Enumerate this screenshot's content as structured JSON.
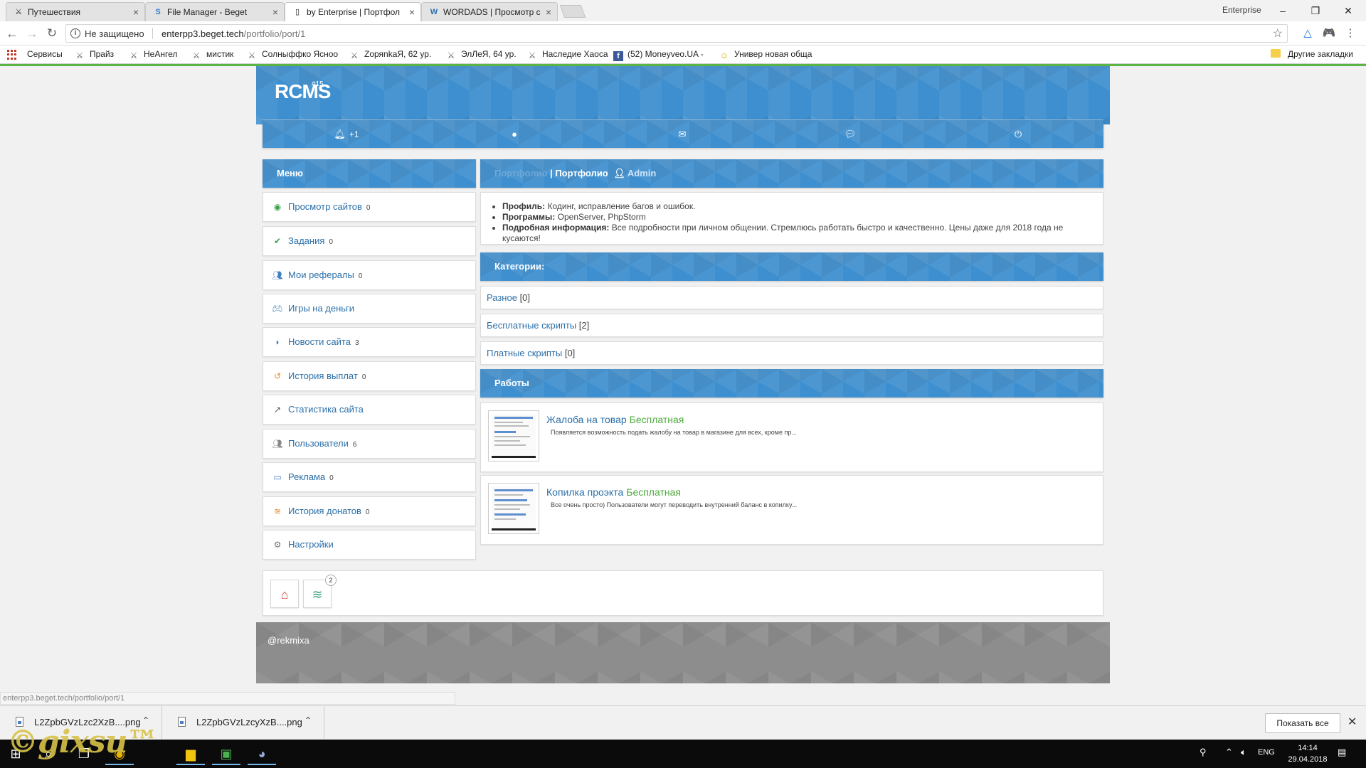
{
  "browser": {
    "tabs": [
      {
        "title": "Путешествия",
        "favicon": "sword-icon",
        "active": false
      },
      {
        "title": "File Manager - Beget",
        "favicon": "beget-icon",
        "active": false
      },
      {
        "title": "by Enterprise | Портфол",
        "favicon": "page-icon",
        "active": true
      },
      {
        "title": "WORDADS | Просмотр с",
        "favicon": "w-icon",
        "active": false
      }
    ],
    "profile_name": "Enterprise",
    "security_label": "Не защищено",
    "url_host": "enterpp3.beget.tech",
    "url_path": "/portfolio/port/1",
    "bookmarks": [
      {
        "label": "Сервисы",
        "icon": "apps-icon"
      },
      {
        "label": "Прайз",
        "icon": "sword-icon"
      },
      {
        "label": "НеАнгел",
        "icon": "sword-icon"
      },
      {
        "label": "мистик",
        "icon": "sword-icon"
      },
      {
        "label": "Солныффко Ясноо",
        "icon": "sword-icon"
      },
      {
        "label": "ZоряnkaЯ, 62 ур.",
        "icon": "sword-icon"
      },
      {
        "label": "ЭлЛеЯ, 64 ур.",
        "icon": "sword-icon"
      },
      {
        "label": "Наследие Хаоса",
        "icon": "sword-icon"
      },
      {
        "label": "(52) Moneyveo.UA -",
        "icon": "facebook-icon"
      },
      {
        "label": "Универ новая обща",
        "icon": "smiley-icon"
      }
    ],
    "other_bookmarks": "Другие закладки"
  },
  "site": {
    "logo": "RCMS",
    "logo_sup": "#15",
    "topnav": [
      {
        "icon": "bell-icon",
        "badge": "+1"
      },
      {
        "icon": "user-icon",
        "badge": ""
      },
      {
        "icon": "envelope-icon",
        "badge": ""
      },
      {
        "icon": "chat-icon",
        "badge": ""
      },
      {
        "icon": "power-icon",
        "badge": ""
      }
    ],
    "menu_title": "Меню",
    "menu": [
      {
        "label": "Просмотр сайтов",
        "count": "0",
        "icon": "eye-icon",
        "color": "#3aa04a"
      },
      {
        "label": "Задания",
        "count": "0",
        "icon": "check-icon",
        "color": "#3aa04a"
      },
      {
        "label": "Мои рефералы",
        "count": "0",
        "icon": "users-icon",
        "color": "#3f7fc0"
      },
      {
        "label": "Игры на деньги",
        "count": "",
        "icon": "gamepad-icon",
        "color": "#3f7fc0"
      },
      {
        "label": "Новости сайта",
        "count": "3",
        "icon": "rss-icon",
        "color": "#3f7fc0"
      },
      {
        "label": "История выплат",
        "count": "0",
        "icon": "history-icon",
        "color": "#e58a2b"
      },
      {
        "label": "Статистика сайта",
        "count": "",
        "icon": "chart-icon",
        "color": "#555555"
      },
      {
        "label": "Пользователи",
        "count": "6",
        "icon": "group-icon",
        "color": "#888888"
      },
      {
        "label": "Реклама",
        "count": "0",
        "icon": "monitor-icon",
        "color": "#3f7fc0"
      },
      {
        "label": "История донатов",
        "count": "0",
        "icon": "donate-icon",
        "color": "#e58a2b"
      },
      {
        "label": "Настройки",
        "count": "",
        "icon": "gear-icon",
        "color": "#777777"
      }
    ],
    "breadcrumb": {
      "link": "Портфолио",
      "separator": " | ",
      "current": "Портфолио",
      "user": "Admin"
    },
    "profile": [
      {
        "label": "Профиль:",
        "value": "Кодинг, исправление багов и ошибок."
      },
      {
        "label": "Программы:",
        "value": "OpenServer, PhpStorm"
      },
      {
        "label": "Подробная информация:",
        "value": "Все подробности при личном общении. Стремлюсь работать быстро и качественно. Цены даже для 2018 года не кусаются!"
      }
    ],
    "categories_title": "Категории:",
    "categories": [
      {
        "label": "Разное",
        "count": "[0]"
      },
      {
        "label": "Бесплатные скрипты",
        "count": "[2]"
      },
      {
        "label": "Платные скрипты",
        "count": "[0]"
      }
    ],
    "works_title": "Работы",
    "works": [
      {
        "title": "Жалоба на товар",
        "price": "Бесплатная",
        "desc": "Появляется возможность подать жалобу на товар в магазине для всех, кроме пр..."
      },
      {
        "title": "Копилка проэкта",
        "price": "Бесплатная",
        "desc": "Все очень просто) Пользователи могут переводить внутренний баланс в копилку..."
      }
    ],
    "bottom_badge": "2",
    "footer": "@rekmixa",
    "accent": "#3e8fcf"
  },
  "status_url": "enterpp3.beget.tech/portfolio/port/1",
  "downloads": {
    "items": [
      {
        "name": "L2ZpbGVzLzc2XzB....png"
      },
      {
        "name": "L2ZpbGVzLzcyXzB....png"
      }
    ],
    "show_all": "Показать все"
  },
  "taskbar": {
    "lang": "ENG",
    "time": "14:14",
    "date": "29.04.2018",
    "watermark": "©gixsu™"
  }
}
